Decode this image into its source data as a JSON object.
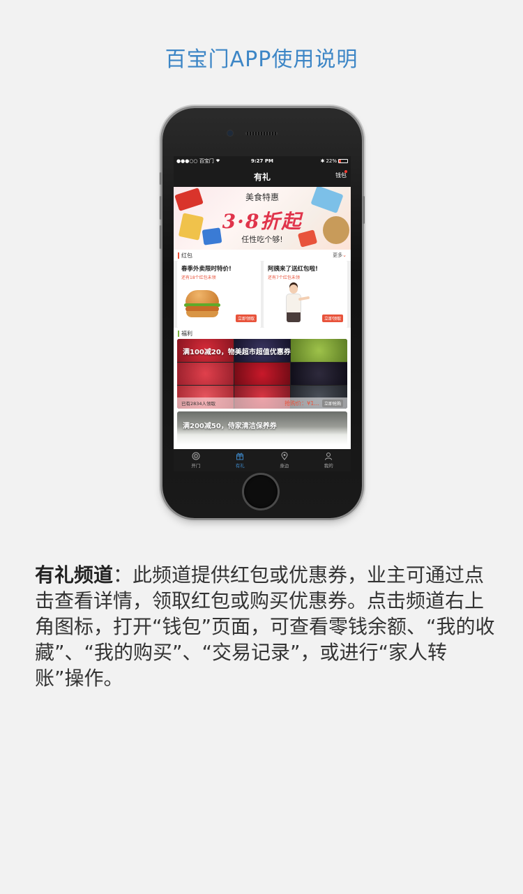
{
  "page": {
    "title": "百宝门APP使用说明"
  },
  "status_bar": {
    "carrier": "●●●○○ 百宝门",
    "time": "9:27 PM",
    "battery": "22%",
    "battery_level": 0.22
  },
  "nav": {
    "title": "有礼",
    "wallet_label": "钱包"
  },
  "banner": {
    "top_text": "美食特惠",
    "main_text": "3·8折起",
    "bottom_text": "任性吃个够!"
  },
  "redpack_section": {
    "title": "红包",
    "more_label": "更多",
    "accent_color": "#e8533b",
    "cards": [
      {
        "title": "春季外卖限时特价!",
        "subtitle": "还有18个红包未领",
        "button": "立即领取",
        "image": "burger"
      },
      {
        "title": "阿姨来了送红包啦!",
        "subtitle": "还有7个红包未领",
        "button": "立即领取",
        "image": "housekeeper"
      }
    ]
  },
  "welfare_section": {
    "title": "福利",
    "accent_color": "#7cb342",
    "coupons": [
      {
        "title": "满100减20，物美超市超值优惠券",
        "claimed": "已有2834人领取",
        "price": "抢购价：¥1...",
        "button": "立即抢购"
      },
      {
        "title": "满200减50，侍家清洁保养券"
      }
    ]
  },
  "tabbar": {
    "active_color": "#3d86c6",
    "items": [
      {
        "label": "开门",
        "icon": "door-signal-icon"
      },
      {
        "label": "有礼",
        "icon": "gift-icon"
      },
      {
        "label": "身边",
        "icon": "location-pin-icon"
      },
      {
        "label": "我的",
        "icon": "person-icon"
      }
    ]
  },
  "description": {
    "lead": "有礼频道",
    "body": "：此频道提供红包或优惠券，业主可通过点击查看详情，领取红包或购买优惠券。点击频道右上角图标，打开“钱包”页面，可查看零钱余额、“我的收藏”、“我的购买”、“交易记录”，或进行“家人转账”操作。"
  }
}
